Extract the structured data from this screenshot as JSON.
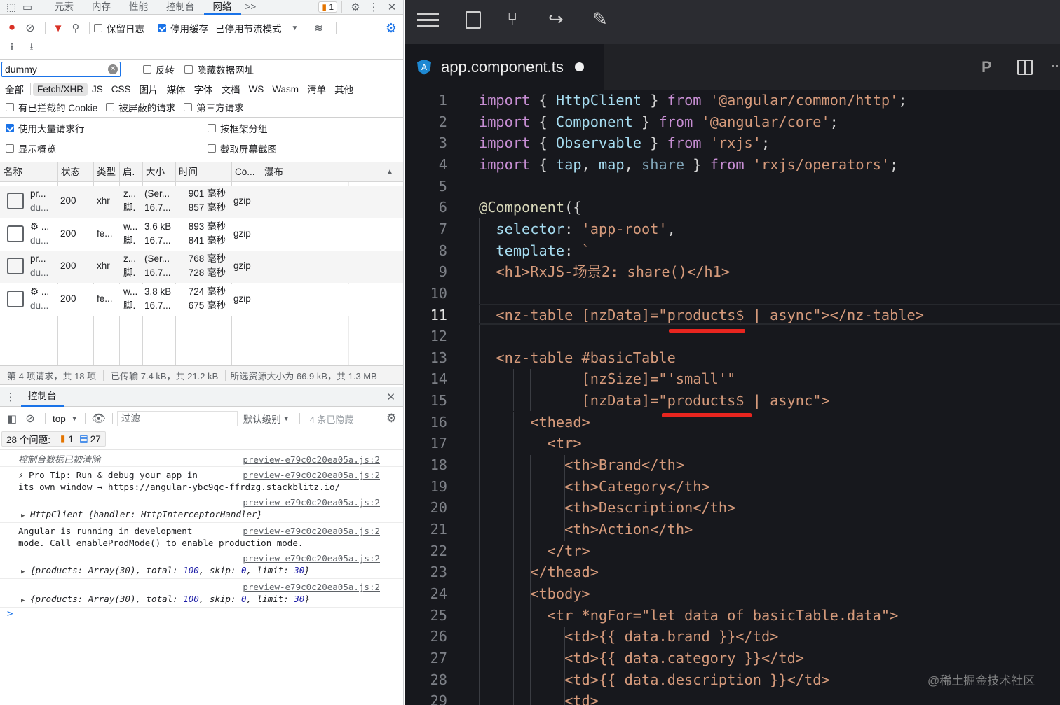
{
  "devtools": {
    "tabs": [
      "元素",
      "内存",
      "性能",
      "控制台",
      "网络"
    ],
    "active_tab": "网络",
    "more_tabs": ">>",
    "issues_badge": "1",
    "toolbar": {
      "preserve_log": "保留日志",
      "disable_cache": "停用缓存",
      "throttling": "已停用节流模式"
    },
    "filter": {
      "value": "dummy",
      "invert": "反转",
      "hide_data_urls": "隐藏数据网址"
    },
    "types": [
      "全部",
      "Fetch/XHR",
      "JS",
      "CSS",
      "图片",
      "媒体",
      "字体",
      "文档",
      "WS",
      "Wasm",
      "清单",
      "其他"
    ],
    "selected_type": "Fetch/XHR",
    "checks": [
      "有已拦截的 Cookie",
      "被屏蔽的请求",
      "第三方请求"
    ],
    "options": {
      "big_rows": "使用大量请求行",
      "group_by_frame": "按框架分组",
      "overview": "显示概览",
      "screenshots": "截取屏幕截图"
    },
    "columns": [
      "名称",
      "状态",
      "类型",
      "启.",
      "大小",
      "时间",
      "Co...",
      "瀑布"
    ],
    "rows": [
      {
        "name1": "pr...",
        "name2": "du...",
        "status": "200",
        "type": "xhr",
        "init1": "z...",
        "init2": "脚.",
        "size1": "(Ser...",
        "size2": "16.7...",
        "time1": "901 毫秒",
        "time2": "857 毫秒",
        "enc": "gzip"
      },
      {
        "name1": "⚙ ...",
        "name2": "du...",
        "status": "200",
        "type": "fe...",
        "init1": "w...",
        "init2": "脚.",
        "size1": "3.6 kB",
        "size2": "16.7...",
        "time1": "893 毫秒",
        "time2": "841 毫秒",
        "enc": "gzip"
      },
      {
        "name1": "pr...",
        "name2": "du...",
        "status": "200",
        "type": "xhr",
        "init1": "z...",
        "init2": "脚.",
        "size1": "(Ser...",
        "size2": "16.7...",
        "time1": "768 毫秒",
        "time2": "728 毫秒",
        "enc": "gzip"
      },
      {
        "name1": "⚙ ...",
        "name2": "du...",
        "status": "200",
        "type": "fe...",
        "init1": "w...",
        "init2": "脚.",
        "size1": "3.8 kB",
        "size2": "16.7...",
        "time1": "724 毫秒",
        "time2": "675 毫秒",
        "enc": "gzip"
      }
    ],
    "status_bar": [
      "第 4 项请求，共 18 项",
      "已传输 7.4 kB，共 21.2 kB",
      "所选资源大小为 66.9 kB，共 1.3 MB"
    ],
    "console": {
      "title": "控制台",
      "context": "top",
      "filter_placeholder": "过滤",
      "level": "默认级别",
      "hidden": "4 条已隐藏",
      "issues_label": "28 个问题:",
      "issues_warn": "1",
      "issues_info": "27",
      "source": "preview-e79c0c20ea05a.js:2",
      "cleared": "控制台数据已被清除",
      "tip1": "⚡ Pro Tip: Run & debug your app in",
      "tip2": "its own window → ",
      "tip_link": "https://angular-ybc9qc-ffrdzg.stackblitz.io/",
      "httpclient": "HttpClient {handler: HttpInterceptorHandler}",
      "dev1": "Angular is running in development",
      "dev2": "mode. Call enableProdMode() to enable production mode.",
      "obj_pre": "{products: Array(30), total: ",
      "total": "100",
      "obj_mid": ", skip: ",
      "skip": "0",
      "obj_mid2": ", limit: ",
      "limit": "30",
      "obj_end": "}",
      "prompt": ">"
    }
  },
  "editor": {
    "tab_title": "app.component.ts",
    "colors": {
      "underline": "#e8251f",
      "background": "#17181d"
    },
    "current_line": 11,
    "lines": [
      [
        [
          "import",
          "k"
        ],
        [
          " { ",
          "p"
        ],
        [
          "HttpClient",
          "i"
        ],
        [
          " } ",
          "p"
        ],
        [
          "from",
          "k"
        ],
        [
          " ",
          "p"
        ],
        [
          "'@angular/common/http'",
          "s"
        ],
        [
          ";",
          "p"
        ]
      ],
      [
        [
          "import",
          "k"
        ],
        [
          " { ",
          "p"
        ],
        [
          "Component",
          "i"
        ],
        [
          " } ",
          "p"
        ],
        [
          "from",
          "k"
        ],
        [
          " ",
          "p"
        ],
        [
          "'@angular/core'",
          "s"
        ],
        [
          ";",
          "p"
        ]
      ],
      [
        [
          "import",
          "k"
        ],
        [
          " { ",
          "p"
        ],
        [
          "Observable",
          "i"
        ],
        [
          " } ",
          "p"
        ],
        [
          "from",
          "k"
        ],
        [
          " ",
          "p"
        ],
        [
          "'rxjs'",
          "s"
        ],
        [
          ";",
          "p"
        ]
      ],
      [
        [
          "import",
          "k"
        ],
        [
          " { ",
          "p"
        ],
        [
          "tap",
          "i"
        ],
        [
          ", ",
          "p"
        ],
        [
          "map",
          "i"
        ],
        [
          ", ",
          "p"
        ],
        [
          "share",
          "d"
        ],
        [
          " } ",
          "p"
        ],
        [
          "from",
          "k"
        ],
        [
          " ",
          "p"
        ],
        [
          "'rxjs/operators'",
          "s"
        ],
        [
          ";",
          "p"
        ]
      ],
      [],
      [
        [
          "@Component",
          "a"
        ],
        [
          "({",
          "p"
        ]
      ],
      [
        [
          "  selector",
          "i"
        ],
        [
          ": ",
          "p"
        ],
        [
          "'app-root'",
          "s"
        ],
        [
          ",",
          "p"
        ]
      ],
      [
        [
          "  template",
          "i"
        ],
        [
          ": ",
          "p"
        ],
        [
          "`",
          "s"
        ]
      ],
      [
        [
          "  <h1>RxJS-场景2: share()</h1>",
          "h"
        ]
      ],
      [],
      [
        [
          "  <nz-table [nzData]=\"products$ | async\"></nz-table>",
          "h"
        ]
      ],
      [],
      [
        [
          "  <nz-table #basicTable",
          "h"
        ]
      ],
      [
        [
          "            [nzSize]=\"'small'\"",
          "h"
        ]
      ],
      [
        [
          "            [nzData]=\"products$ | async\">",
          "h"
        ]
      ],
      [
        [
          "      <thead>",
          "h"
        ]
      ],
      [
        [
          "        <tr>",
          "h"
        ]
      ],
      [
        [
          "          <th>Brand</th>",
          "h"
        ]
      ],
      [
        [
          "          <th>Category</th>",
          "h"
        ]
      ],
      [
        [
          "          <th>Description</th>",
          "h"
        ]
      ],
      [
        [
          "          <th>Action</th>",
          "h"
        ]
      ],
      [
        [
          "        </tr>",
          "h"
        ]
      ],
      [
        [
          "      </thead>",
          "h"
        ]
      ],
      [
        [
          "      <tbody>",
          "h"
        ]
      ],
      [
        [
          "        <tr *ngFor=\"let data of basicTable.data\">",
          "h"
        ]
      ],
      [
        [
          "          <td>{{ data.brand }}</td>",
          "h"
        ]
      ],
      [
        [
          "          <td>{{ data.category }}</td>",
          "h"
        ]
      ],
      [
        [
          "          <td>{{ data.description }}</td>",
          "h"
        ]
      ],
      [
        [
          "          <td>",
          "h"
        ]
      ]
    ]
  },
  "watermark": "@稀土掘金技术社区"
}
